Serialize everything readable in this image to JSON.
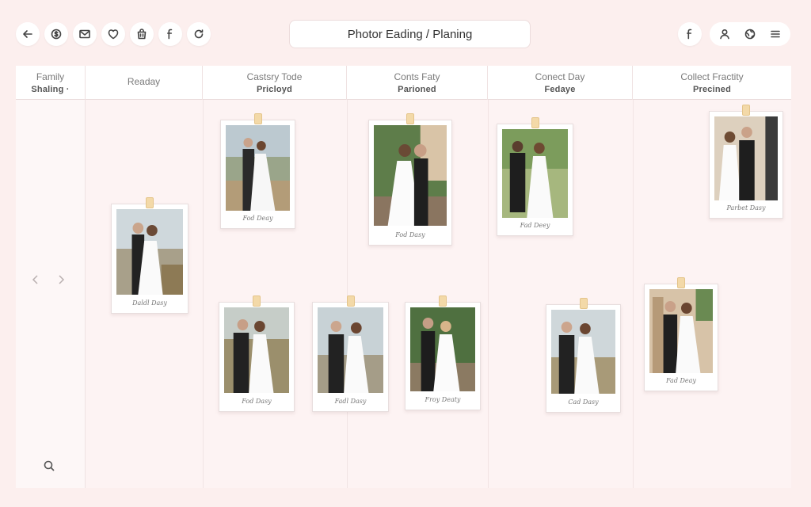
{
  "toolbar": {
    "left_icons": [
      "back-arrow-icon",
      "dollar-icon",
      "mail-icon",
      "heart-icon",
      "bag-icon",
      "facebook-icon",
      "refresh-icon"
    ],
    "title": "Photor Eading / Planing",
    "right_icons": [
      "facebook-icon",
      "user-icon",
      "globe-icon",
      "menu-icon"
    ]
  },
  "columns": [
    {
      "title": "Family",
      "subtitle": "Shaling ·"
    },
    {
      "title": "Readay",
      "subtitle": ""
    },
    {
      "title": "Castsry Tode",
      "subtitle": "Pricloyd"
    },
    {
      "title": "Conts Faty",
      "subtitle": "Parioned"
    },
    {
      "title": "Conect Day",
      "subtitle": "Fedaye"
    },
    {
      "title": "Collect Fractity",
      "subtitle": "Precined"
    }
  ],
  "cards": [
    {
      "caption": "Daldl Dasy"
    },
    {
      "caption": "Fod Deay"
    },
    {
      "caption": "Fod Dasy"
    },
    {
      "caption": "Fad Deey"
    },
    {
      "caption": "Parbet Dasy"
    },
    {
      "caption": "Fod Dasy"
    },
    {
      "caption": "Fadl Dasy"
    },
    {
      "caption": "Froy Deaty"
    },
    {
      "caption": "Cad Dasy"
    },
    {
      "caption": "Fad Deay"
    }
  ],
  "colors": {
    "background": "#fcefee",
    "card": "#ffffff",
    "clip": "#f3d9a8"
  }
}
